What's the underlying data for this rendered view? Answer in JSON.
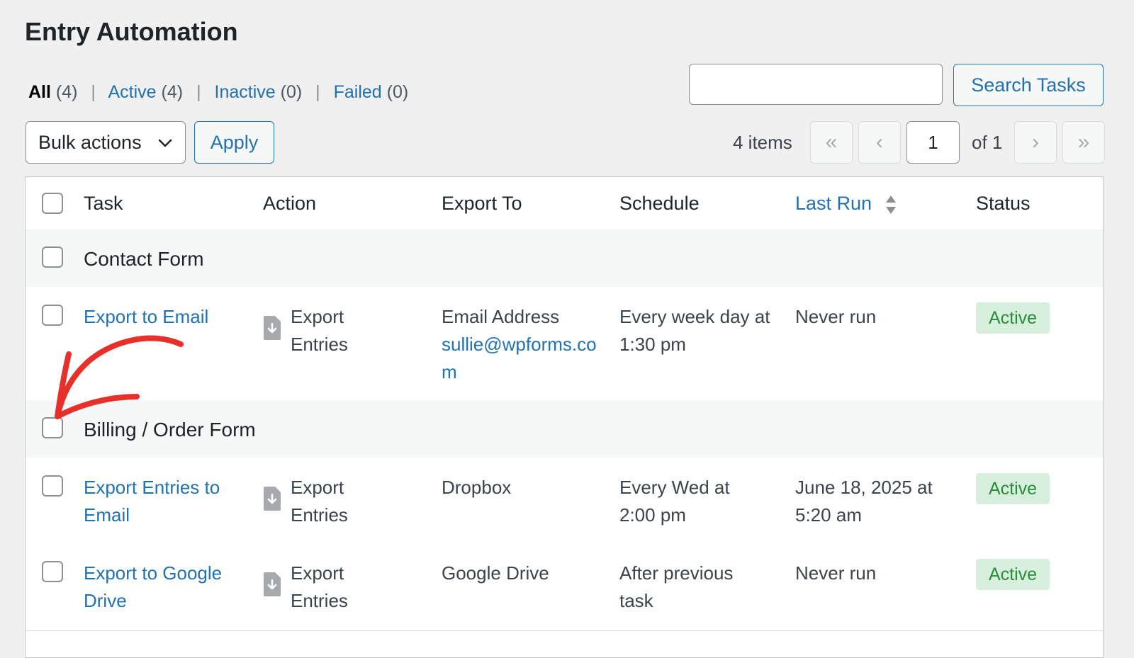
{
  "page": {
    "title": "Entry Automation"
  },
  "filters": [
    {
      "label": "All",
      "count": "(4)",
      "current": true
    },
    {
      "label": "Active",
      "count": "(4)",
      "current": false
    },
    {
      "label": "Inactive",
      "count": "(0)",
      "current": false
    },
    {
      "label": "Failed",
      "count": "(0)",
      "current": false
    }
  ],
  "search": {
    "button_label": "Search Tasks",
    "value": ""
  },
  "bulk": {
    "selected": "Bulk actions",
    "apply_label": "Apply"
  },
  "pagination": {
    "items": "4 items",
    "first": "«",
    "prev": "‹",
    "next": "›",
    "last": "»",
    "current_page": "1",
    "of_total": "of 1"
  },
  "table": {
    "headers": {
      "task": "Task",
      "action": "Action",
      "export_to": "Export To",
      "schedule": "Schedule",
      "last_run": "Last Run",
      "status": "Status"
    },
    "groups": [
      {
        "name": "Contact Form",
        "rows": [
          {
            "task": "Export to Email",
            "action": "Export Entries",
            "export_label": "Email Address",
            "export_link": "sullie@wpforms.com",
            "schedule": "Every week day at 1:30 pm",
            "last_run": "Never run",
            "status": "Active"
          }
        ]
      },
      {
        "name": "Billing / Order Form",
        "rows": [
          {
            "task": "Export Entries to Email",
            "action": "Export Entries",
            "export_to": "Dropbox",
            "schedule": "Every Wed at 2:00 pm",
            "last_run": "June 18, 2025 at 5:20 am",
            "status": "Active"
          },
          {
            "task": "Export to Google Drive",
            "action": "Export Entries",
            "export_to": "Google Drive",
            "schedule": "After previous task",
            "last_run": "Never run",
            "status": "Active"
          }
        ]
      }
    ]
  },
  "colors": {
    "link": "#2271b1",
    "active_badge_bg": "#d7f0dd",
    "active_badge_text": "#2a8b3c",
    "annotation_arrow": "#e8302a"
  },
  "icons": {
    "action": "file-download-icon",
    "sort": "sort-arrows-icon",
    "dropdown": "chevron-down-icon"
  }
}
